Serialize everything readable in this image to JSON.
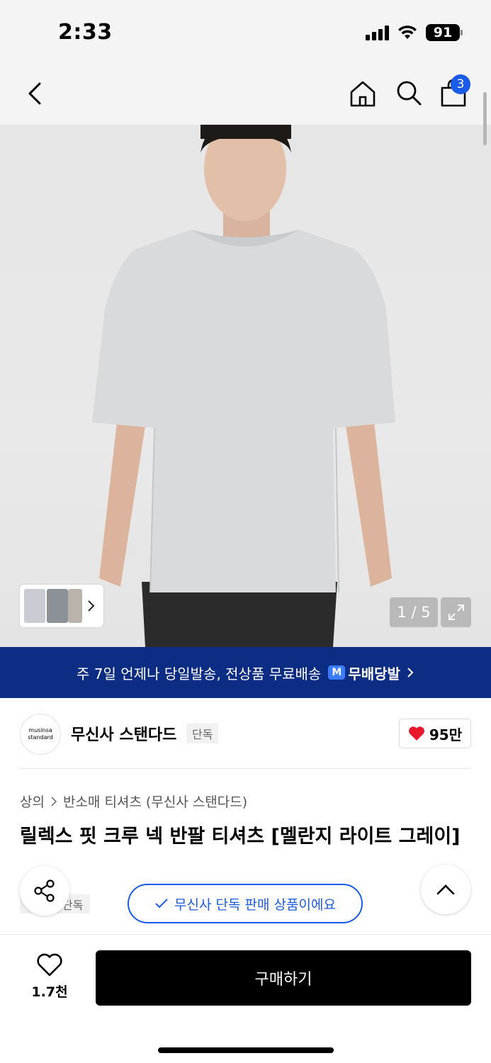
{
  "status_bar": {
    "time": "2:33",
    "battery": "91"
  },
  "nav": {
    "cart_count": "3",
    "icons": [
      "back-icon",
      "home-icon",
      "search-icon",
      "cart-icon"
    ]
  },
  "gallery": {
    "page_counter": "1 / 5"
  },
  "delivery_banner": {
    "text": "주 7일 언제나 당일발송, 전상품 무료배송",
    "logo_letter": "M",
    "brand": "무배당발"
  },
  "brand": {
    "logo_line1": "musinsa",
    "logo_line2": "standard",
    "name": "무신사 스탠다드",
    "tag": "단독",
    "like_count": "95만"
  },
  "breadcrumb": {
    "category": "상의",
    "subcategory": "반소매 티셔츠 (무신사 스탠다드)"
  },
  "product": {
    "title": "릴렉스 핏 크루 넥 반팔 티셔츠 [멜란지 라이트 그레이]",
    "tag": "단독"
  },
  "exclusive_pill": {
    "label": "무신사 단독 판매 상품이에요"
  },
  "bottom_bar": {
    "wish_count": "1.7천",
    "buy_label": "구매하기"
  },
  "colors": {
    "accent_blue": "#1a5be8",
    "banner_navy": "#0d2c84",
    "heart_red": "#e8192c"
  }
}
